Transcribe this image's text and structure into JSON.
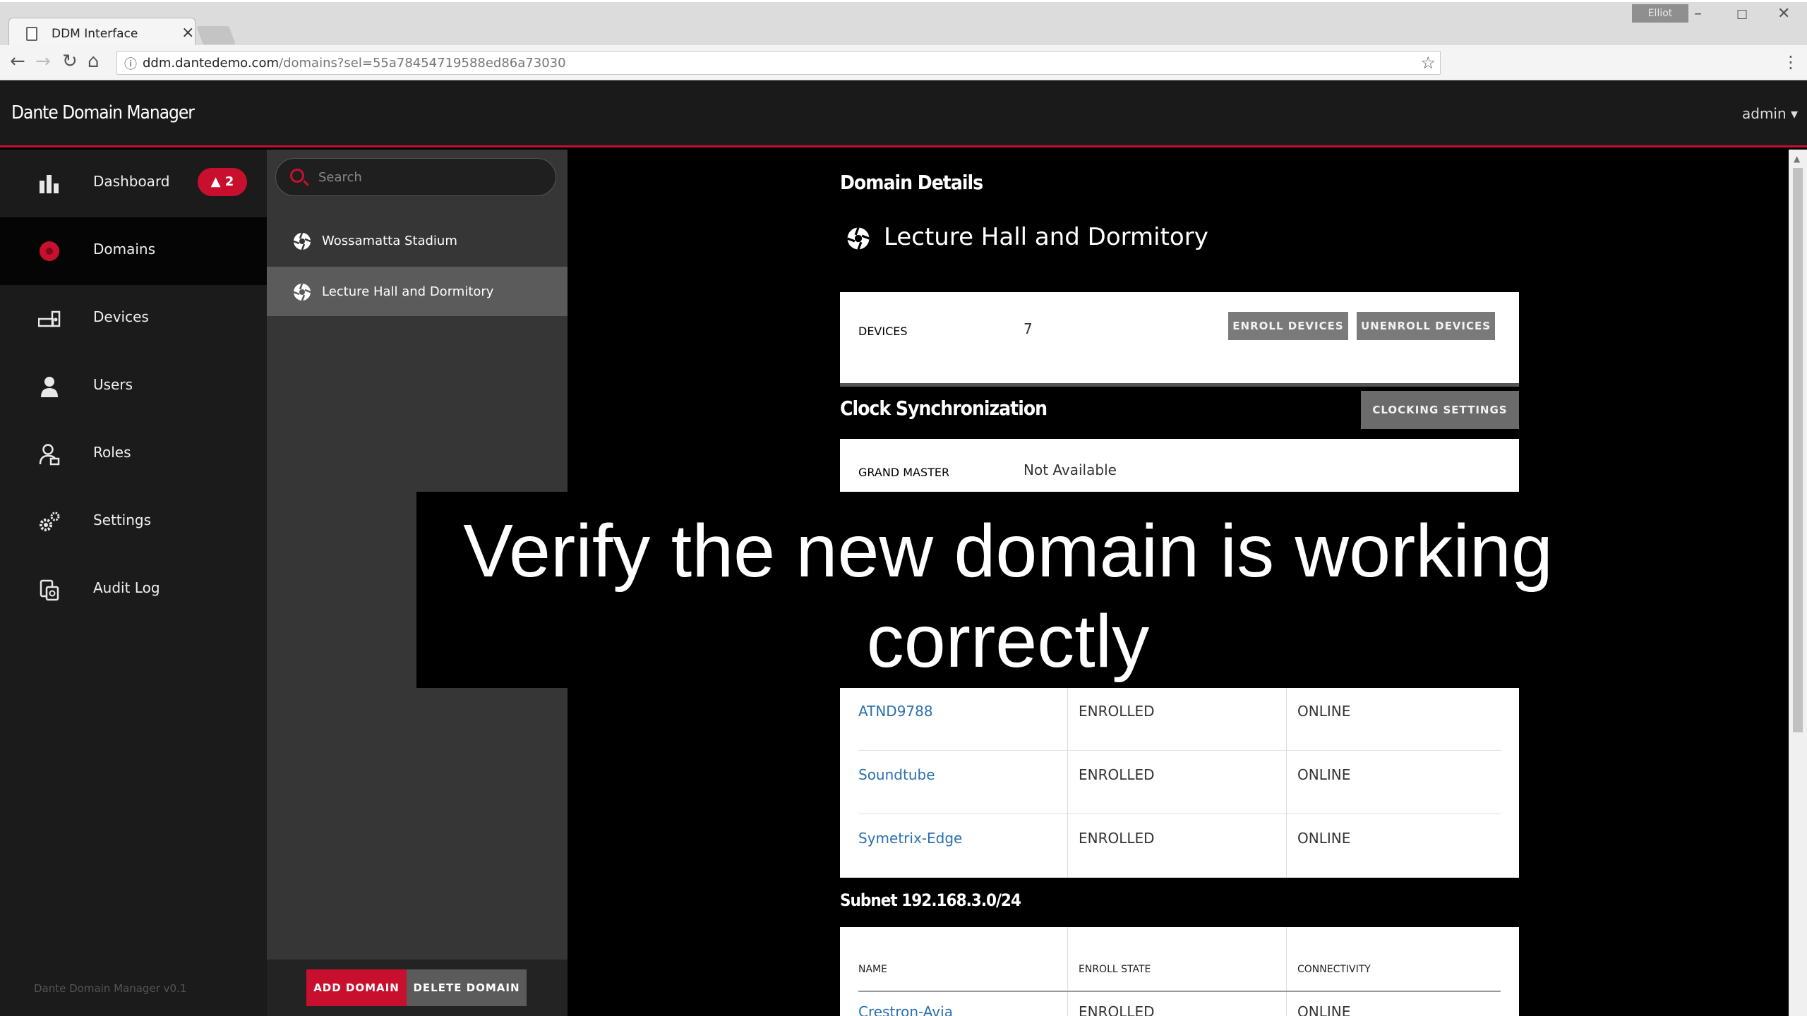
{
  "browser": {
    "tab_title": "DDM Interface",
    "tab_close": "×",
    "user_chip": "Elliot",
    "window_controls": {
      "minimize": "–",
      "maximize": "☐",
      "close": "✕"
    },
    "nav": {
      "back": "←",
      "forward": "→",
      "reload": "↻",
      "home": "⌂"
    },
    "url_host": "ddm.dantedemo.com",
    "url_path": "/domains?sel=55a78454719588ed86a73030",
    "info_icon": "ⓘ",
    "bookmark_icon": "☆",
    "menu_icon": "⋮"
  },
  "app": {
    "title": "Dante Domain Manager",
    "user_menu": "admin ▾",
    "version": "Dante Domain Manager v0.1"
  },
  "sidebar": {
    "items": [
      {
        "label": "Dashboard",
        "icon": "bar-chart-icon"
      },
      {
        "label": "Domains",
        "icon": "domain-icon"
      },
      {
        "label": "Devices",
        "icon": "devices-icon"
      },
      {
        "label": "Users",
        "icon": "user-icon"
      },
      {
        "label": "Roles",
        "icon": "roles-icon"
      },
      {
        "label": "Settings",
        "icon": "gears-icon"
      },
      {
        "label": "Audit Log",
        "icon": "audit-log-icon"
      }
    ],
    "alert_badge": "▲ 2",
    "active_index": 1
  },
  "domain_panel": {
    "search_placeholder": "Search",
    "domains": [
      {
        "label": "Wossamatta Stadium"
      },
      {
        "label": "Lecture Hall and Dormitory"
      }
    ],
    "selected_index": 1,
    "add_label": "ADD DOMAIN",
    "delete_label": "DELETE DOMAIN"
  },
  "details": {
    "heading": "Domain Details",
    "domain_name": "Lecture Hall and Dormitory",
    "devices_label": "DEVICES",
    "devices_count": "7",
    "enroll_label": "ENROLL DEVICES",
    "unenroll_label": "UNENROLL DEVICES",
    "clock_heading": "Clock Synchronization",
    "clock_button": "CLOCKING SETTINGS",
    "grand_master_label": "GRAND MASTER",
    "grand_master_value": "Not Available",
    "device_rows": [
      {
        "name": "ATND9788",
        "state": "ENROLLED",
        "connectivity": "ONLINE"
      },
      {
        "name": "Soundtube",
        "state": "ENROLLED",
        "connectivity": "ONLINE"
      },
      {
        "name": "Symetrix-Edge",
        "state": "ENROLLED",
        "connectivity": "ONLINE"
      }
    ],
    "subnet_heading": "Subnet 192.168.3.0/24",
    "subnet_headers": {
      "name": "NAME",
      "state": "ENROLL STATE",
      "connectivity": "CONNECTIVITY"
    },
    "subnet_partial": {
      "name": "Crestron-Avia",
      "state": "ENROLLED",
      "connectivity": "ONLINE"
    }
  },
  "caption": "Verify the new domain is working correctly",
  "colors": {
    "accent": "#c8102e",
    "link": "#2a6fb0",
    "sidebar_bg": "#1b1b1b",
    "panel_bg": "#363636"
  }
}
